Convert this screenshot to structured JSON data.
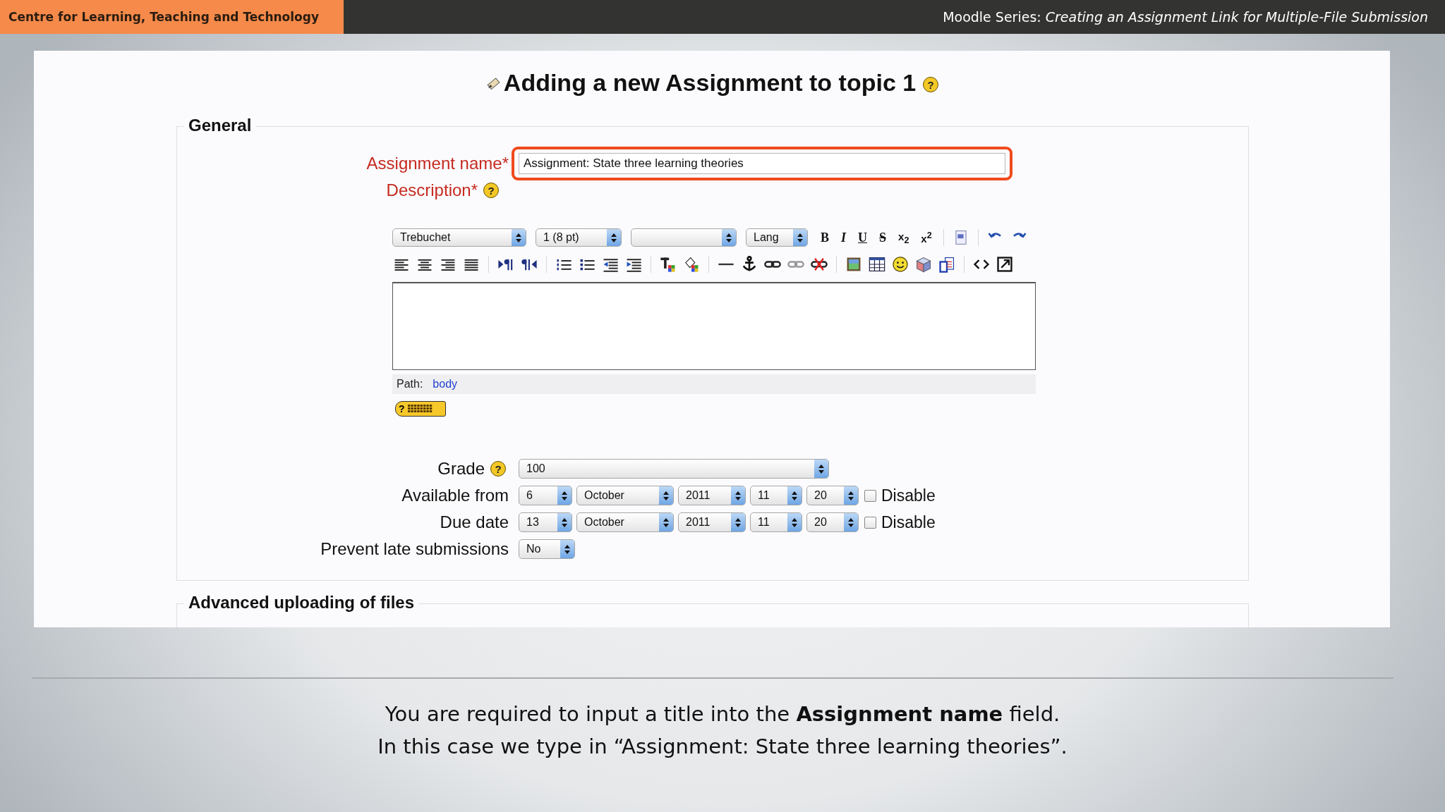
{
  "header": {
    "org": "Centre for Learning, Teaching and Technology",
    "series": "Moodle Series: *Creating an Assignment Link for Multiple-File Submission*"
  },
  "page": {
    "title": "Adding a new Assignment to topic 1",
    "help": "?"
  },
  "general": {
    "legend": "General",
    "name_field": {
      "label": "Assignment name*",
      "value": "Assignment: State three learning theories",
      "highlighted": true
    },
    "description": {
      "label": "Description*",
      "help": "?"
    },
    "editor": {
      "selects": [
        {
          "value": "Trebuchet"
        },
        {
          "value": "1 (8 pt)"
        },
        {
          "kind": "blank"
        },
        {
          "value": "Lang"
        }
      ],
      "format_buttons": [
        {
          "kind": "bold",
          "label": "B"
        },
        {
          "kind": "italic",
          "label": "I"
        },
        {
          "kind": "underline",
          "label": "U"
        },
        {
          "kind": "strike",
          "label": "S"
        },
        {
          "kind": "subscript",
          "label": "x$_{2}$"
        },
        {
          "kind": "superscript",
          "label": "x$^{2}$"
        }
      ],
      "path_label": "Path:",
      "path_link": "body",
      "keyboard_help": "?"
    },
    "grade": {
      "label": "Grade",
      "help": "?",
      "value": "100"
    },
    "dates": [
      {
        "label": "Available from",
        "day": "6",
        "month": "October",
        "year": "2011",
        "hour": "11",
        "minute": "20",
        "disable_label": "Disable",
        "checked": false
      },
      {
        "label": "Due date",
        "day": "13",
        "month": "October",
        "year": "2011",
        "hour": "11",
        "minute": "20",
        "disable_label": "Disable",
        "checked": false
      }
    ],
    "late": {
      "label": "Prevent late submissions",
      "value": "No"
    }
  },
  "advanced": {
    "legend": "Advanced uploading of files"
  },
  "caption": [
    "You are required to input a title into the **Assignment name** field.",
    "In this case we type in “Assignment: State three learning theories”."
  ]
}
